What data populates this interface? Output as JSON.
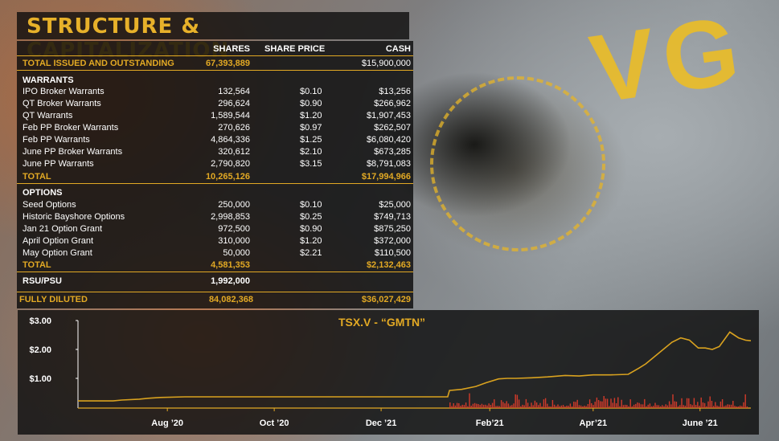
{
  "title": "STRUCTURE & CAPITALIZATION",
  "headers": {
    "shares": "SHARES",
    "price": "SHARE PRICE",
    "cash": "CASH"
  },
  "total_issued": {
    "label": "TOTAL ISSUED AND OUTSTANDING",
    "shares": "67,393,889",
    "cash": "$15,900,000"
  },
  "warrants": {
    "heading": "WARRANTS",
    "rows": [
      {
        "label": "IPO Broker Warrants",
        "shares": "132,564",
        "price": "$0.10",
        "cash": "$13,256"
      },
      {
        "label": "QT Broker Warrants",
        "shares": "296,624",
        "price": "$0.90",
        "cash": "$266,962"
      },
      {
        "label": "QT Warrants",
        "shares": "1,589,544",
        "price": "$1.20",
        "cash": "$1,907,453"
      },
      {
        "label": "Feb PP Broker Warrants",
        "shares": "270,626",
        "price": "$0.97",
        "cash": "$262,507"
      },
      {
        "label": "Feb PP Warrants",
        "shares": "4,864,336",
        "price": "$1.25",
        "cash": "$6,080,420"
      },
      {
        "label": "June PP Broker Warrants",
        "shares": "320,612",
        "price": "$2.10",
        "cash": "$673,285"
      },
      {
        "label": "June PP Warrants",
        "shares": "2,790,820",
        "price": "$3.15",
        "cash": "$8,791,083"
      }
    ],
    "total": {
      "label": "TOTAL",
      "shares": "10,265,126",
      "cash": "$17,994,966"
    }
  },
  "options": {
    "heading": "OPTIONS",
    "rows": [
      {
        "label": "Seed Options",
        "shares": "250,000",
        "price": "$0.10",
        "cash": "$25,000"
      },
      {
        "label": "Historic Bayshore Options",
        "shares": "2,998,853",
        "price": "$0.25",
        "cash": "$749,713"
      },
      {
        "label": "Jan 21 Option Grant",
        "shares": "972,500",
        "price": "$0.90",
        "cash": "$875,250"
      },
      {
        "label": "April Option Grant",
        "shares": "310,000",
        "price": "$1.20",
        "cash": "$372,000"
      },
      {
        "label": "May Option Grant",
        "shares": "50,000",
        "price": "$2.21",
        "cash": "$110,500"
      }
    ],
    "total": {
      "label": "TOTAL",
      "shares": "4,581,353",
      "cash": "$2,132,463"
    }
  },
  "rsu": {
    "label": "RSU/PSU",
    "shares": "1,992,000"
  },
  "fully_diluted": {
    "label": "FULLY DILUTED",
    "shares": "84,082,368",
    "cash": "$36,027,429"
  },
  "colors": {
    "accent": "#e2a924",
    "line": "#d9a21f",
    "volume": "#d23a2a"
  },
  "chart_data": {
    "type": "line",
    "title": "TSX.V - “GMTN”",
    "y_ticks": [
      "$3.00",
      "$2.00",
      "$1.00"
    ],
    "x_ticks": [
      "Aug ’20",
      "Oct ’20",
      "Dec ’21",
      "Feb’21",
      "Apr’21",
      "June ’21"
    ],
    "ylim": [
      0.0,
      3.0
    ],
    "x": [
      "2020-06-15",
      "2020-07-05",
      "2020-07-10",
      "2020-07-20",
      "2020-07-25",
      "2020-08-01",
      "2020-08-15",
      "2020-09-01",
      "2020-10-01",
      "2020-11-01",
      "2020-12-01",
      "2021-01-01",
      "2021-01-12",
      "2021-01-13",
      "2021-01-20",
      "2021-01-28",
      "2021-02-03",
      "2021-02-10",
      "2021-02-15",
      "2021-02-20",
      "2021-03-01",
      "2021-03-10",
      "2021-03-20",
      "2021-03-28",
      "2021-04-05",
      "2021-04-15",
      "2021-04-25",
      "2021-05-01",
      "2021-05-05",
      "2021-05-10",
      "2021-05-15",
      "2021-05-20",
      "2021-05-25",
      "2021-05-30",
      "2021-06-04",
      "2021-06-08",
      "2021-06-12",
      "2021-06-16",
      "2021-06-22",
      "2021-06-27",
      "2021-07-01",
      "2021-07-04"
    ],
    "y": [
      0.22,
      0.22,
      0.25,
      0.28,
      0.31,
      0.34,
      0.36,
      0.36,
      0.36,
      0.36,
      0.36,
      0.36,
      0.36,
      0.58,
      0.62,
      0.72,
      0.85,
      0.98,
      1.0,
      1.0,
      1.02,
      1.05,
      1.1,
      1.08,
      1.12,
      1.12,
      1.14,
      1.35,
      1.5,
      1.75,
      2.0,
      2.25,
      2.4,
      2.32,
      2.05,
      2.05,
      2.0,
      2.1,
      2.6,
      2.4,
      2.32,
      2.3
    ],
    "volume_note": ""
  }
}
